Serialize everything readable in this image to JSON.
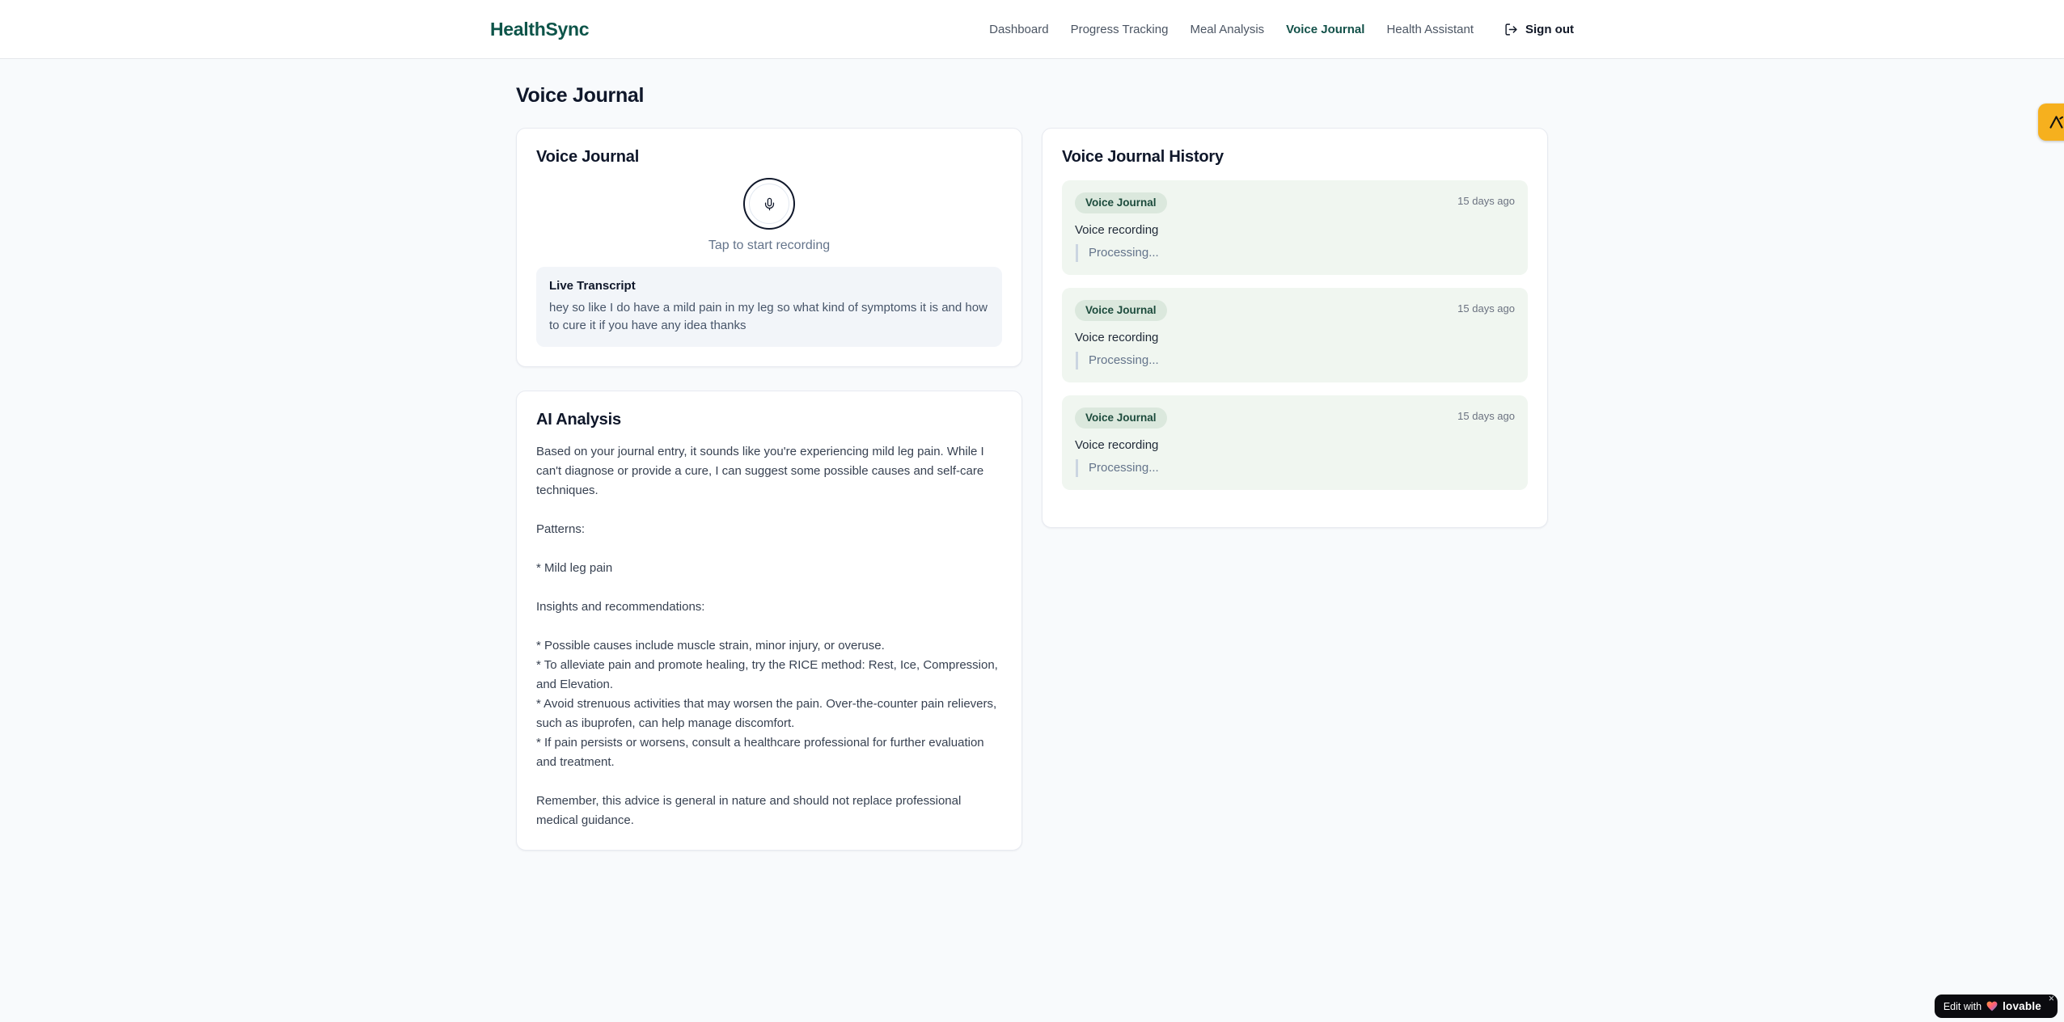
{
  "brand": {
    "name": "HealthSync"
  },
  "nav": {
    "items": [
      {
        "label": "Dashboard",
        "active": false
      },
      {
        "label": "Progress Tracking",
        "active": false
      },
      {
        "label": "Meal Analysis",
        "active": false
      },
      {
        "label": "Voice Journal",
        "active": true
      },
      {
        "label": "Health Assistant",
        "active": false
      }
    ],
    "sign_out_label": "Sign out",
    "sign_out_icon": "log-out-icon"
  },
  "page": {
    "title": "Voice Journal"
  },
  "recorder_card": {
    "title": "Voice Journal",
    "mic_icon": "microphone-icon",
    "tap_label": "Tap to start recording",
    "transcript": {
      "title": "Live Transcript",
      "text": "hey so like I do have a mild pain in my leg so what kind of symptoms it is and how to cure it if you have any idea thanks"
    }
  },
  "analysis_card": {
    "title": "AI Analysis",
    "body": "Based on your journal entry, it sounds like you're experiencing mild leg pain. While I can't diagnose or provide a cure, I can suggest some possible causes and self-care techniques.\n\nPatterns:\n\n* Mild leg pain\n\nInsights and recommendations:\n\n* Possible causes include muscle strain, minor injury, or overuse.\n* To alleviate pain and promote healing, try the RICE method: Rest, Ice, Compression, and Elevation.\n* Avoid strenuous activities that may worsen the pain. Over-the-counter pain relievers, such as ibuprofen, can help manage discomfort.\n* If pain persists or worsens, consult a healthcare professional for further evaluation and treatment.\n\nRemember, this advice is general in nature and should not replace professional medical guidance."
  },
  "history_card": {
    "title": "Voice Journal History",
    "entries": [
      {
        "badge": "Voice Journal",
        "time": "15 days ago",
        "title": "Voice recording",
        "status": "Processing..."
      },
      {
        "badge": "Voice Journal",
        "time": "15 days ago",
        "title": "Voice recording",
        "status": "Processing..."
      },
      {
        "badge": "Voice Journal",
        "time": "15 days ago",
        "title": "Voice recording",
        "status": "Processing..."
      }
    ]
  },
  "widgets": {
    "side_tag_icon": "lovable-tag-icon",
    "lovable": {
      "prefix": "Edit with",
      "heart_icon": "heart-icon",
      "brand": "lovable",
      "close": "×"
    }
  },
  "colors": {
    "brand_green": "#0d5449",
    "nav_active": "#135149",
    "page_bg": "#f8fafc",
    "entry_bg": "#f0f6f0",
    "badge_bg": "#dbe8dd",
    "badge_text": "#1c4b3c",
    "side_tag_amber": "#f6b01e",
    "lovable_black": "#0b0b0f"
  }
}
